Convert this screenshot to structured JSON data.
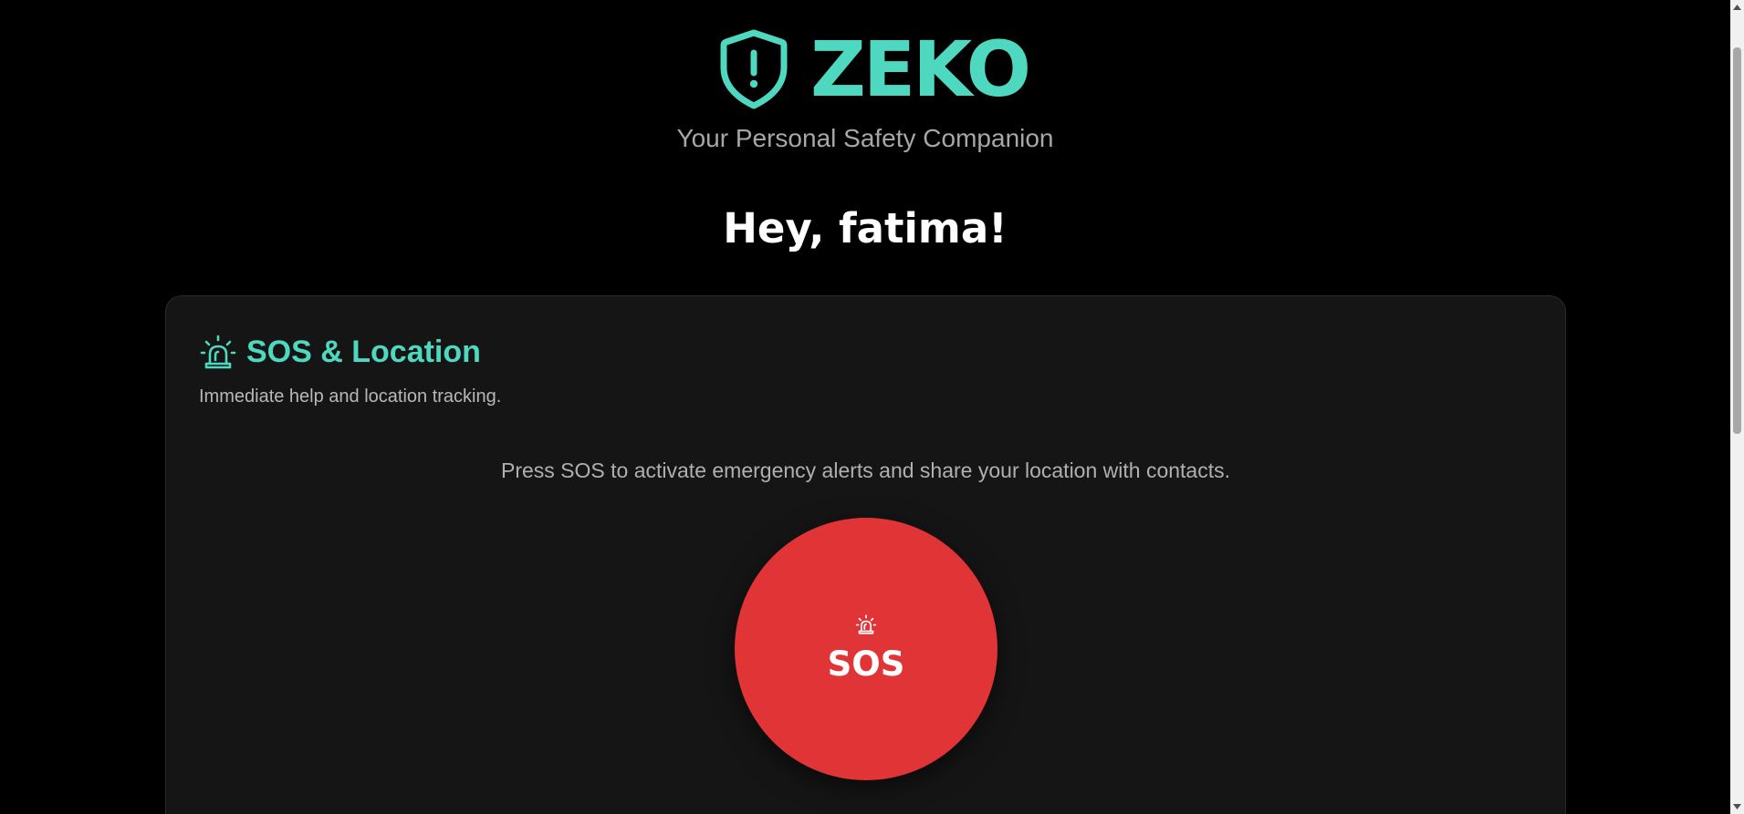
{
  "header": {
    "brand_name": "ZEKO",
    "tagline": "Your Personal Safety Companion",
    "logo_icon": "shield-alert-icon"
  },
  "greeting": "Hey, fatima!",
  "sos_card": {
    "icon": "siren-icon",
    "title": "SOS & Location",
    "subtitle": "Immediate help and location tracking.",
    "description": "Press SOS to activate emergency alerts and share your location with contacts.",
    "button_label": "SOS",
    "button_icon": "siren-icon"
  },
  "colors": {
    "accent": "#4fd8c0",
    "sos_red": "#e03436",
    "background": "#000000",
    "card": "#151515"
  }
}
